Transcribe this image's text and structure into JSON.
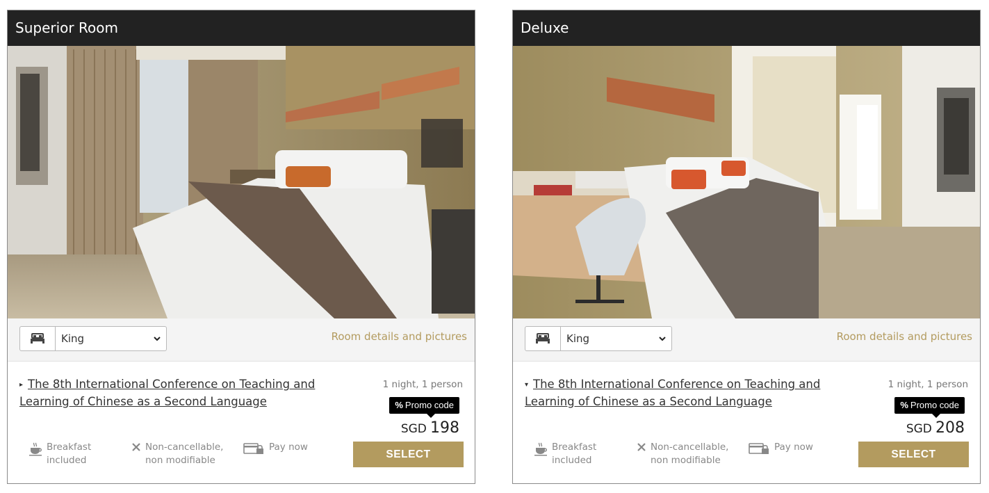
{
  "rooms": [
    {
      "title": "Superior Room",
      "bed_type": "King",
      "details_link": "Room details and pictures",
      "rate": {
        "title_line1": "The 8th International Conference on Teaching and",
        "title_line2": "Learning of Chinese as a Second Language",
        "expanded": false,
        "toggle_glyph": "▸",
        "stay": "1 night, 1 person",
        "promo_symbol": "%",
        "promo_label": "Promo code",
        "currency": "SGD",
        "price": "198",
        "breakfast_line1": "Breakfast",
        "breakfast_line2": "included",
        "cancel_line1": "Non-cancellable,",
        "cancel_line2": "non modifiable",
        "payment": "Pay now",
        "select_label": "SELECT"
      }
    },
    {
      "title": "Deluxe",
      "bed_type": "King",
      "details_link": "Room details and pictures",
      "rate": {
        "title_line1": "The 8th International Conference on Teaching and",
        "title_line2": "Learning of Chinese as a Second Language",
        "expanded": true,
        "toggle_glyph": "▾",
        "stay": "1 night, 1 person",
        "promo_symbol": "%",
        "promo_label": "Promo code",
        "currency": "SGD",
        "price": "208",
        "breakfast_line1": "Breakfast",
        "breakfast_line2": "included",
        "cancel_line1": "Non-cancellable,",
        "cancel_line2": "non modifiable",
        "payment": "Pay now",
        "select_label": "SELECT"
      }
    }
  ],
  "colors": {
    "accent": "#b39b5f",
    "header_bg": "#222222",
    "promo_bg": "#000000"
  },
  "icons": [
    "bed-icon",
    "chevron-down-icon",
    "breakfast-icon",
    "close-icon",
    "card-lock-icon"
  ]
}
